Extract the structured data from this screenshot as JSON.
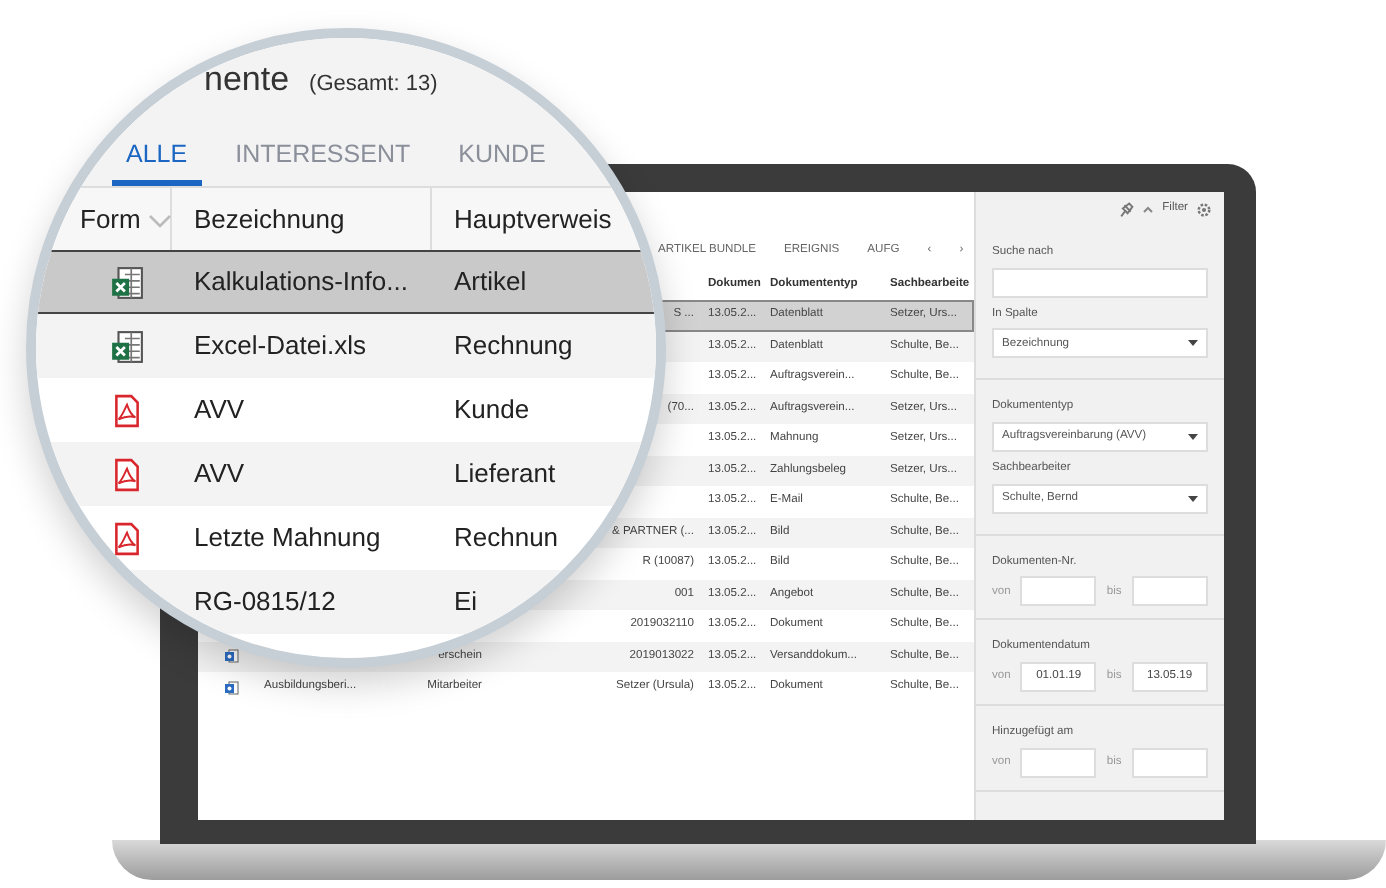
{
  "laptop_screen": {
    "tabs": [
      {
        "label": "ARTIKEL BUNDLE",
        "selected": false
      },
      {
        "label": "EREIGNIS",
        "selected": false
      },
      {
        "label": "AUFG",
        "selected": false
      }
    ],
    "tab_arrows": [
      "‹",
      "›"
    ],
    "table": {
      "columns": [
        "Dokumen",
        "Dokumententyp",
        "Sachbearbeite"
      ],
      "rows": [
        {
          "selected": true,
          "column_4": "S ...",
          "date": "13.05.2...",
          "type": "Datenblatt",
          "clerk": "Setzer, Urs..."
        },
        {
          "selected": false,
          "date": "13.05.2...",
          "type": "Datenblatt",
          "clerk": "Schulte, Be..."
        },
        {
          "selected": false,
          "date": "13.05.2...",
          "type": "Auftragsverein...",
          "clerk": "Schulte, Be..."
        },
        {
          "selected": false,
          "column_4": "(70...",
          "date": "13.05.2...",
          "type": "Auftragsverein...",
          "clerk": "Setzer, Urs..."
        },
        {
          "selected": false,
          "date": "13.05.2...",
          "type": "Mahnung",
          "clerk": "Setzer, Urs..."
        },
        {
          "selected": false,
          "date": "13.05.2...",
          "type": "Zahlungsbeleg",
          "clerk": "Setzer, Urs..."
        },
        {
          "selected": false,
          "date": "13.05.2...",
          "type": "E-Mail",
          "clerk": "Schulte, Be..."
        },
        {
          "selected": false,
          "column_4": "& PARTNER (...",
          "date": "13.05.2...",
          "type": "Bild",
          "clerk": "Schulte, Be..."
        },
        {
          "selected": false,
          "column_4": "R (10087)",
          "date": "13.05.2...",
          "type": "Bild",
          "clerk": "Schulte, Be..."
        },
        {
          "selected": false,
          "column_4": "001",
          "date": "13.05.2...",
          "type": "Angebot",
          "clerk": "Schulte, Be..."
        },
        {
          "selected": false,
          "column_4": "2019032110",
          "date": "13.05.2...",
          "type": "Dokument",
          "clerk": "Schulte, Be..."
        },
        {
          "selected": false,
          "kind": "word",
          "hauptverweis": "erschein",
          "column_4": "2019013022",
          "date": "13.05.2...",
          "type": "Versanddokum...",
          "clerk": "Schulte, Be..."
        },
        {
          "selected": false,
          "kind": "word",
          "bezeichnung": "Ausbildungsberi...",
          "hauptverweis": "Mitarbeiter",
          "column_4": "Setzer (Ursula)",
          "date": "13.05.2...",
          "type": "Dokument",
          "clerk": "Schulte, Be..."
        }
      ]
    },
    "filter": {
      "title": "Filter",
      "sections": [
        [
          {
            "kind": "text",
            "label": "Suche nach"
          },
          {
            "kind": "select",
            "label": "In Spalte",
            "value": "Bezeichnung"
          }
        ],
        [
          {
            "kind": "select",
            "label": "Dokumententyp",
            "value": "Auftragsvereinbarung (AVV)"
          },
          {
            "kind": "select",
            "label": "Sachbearbeiter",
            "value": "Schulte, Bernd"
          }
        ],
        [
          {
            "kind": "range",
            "label": "Dokumenten-Nr.",
            "from_label": "von",
            "to_label": "bis"
          }
        ],
        [
          {
            "kind": "range",
            "label": "Dokumentendatum",
            "from_label": "von",
            "from": "01.01.19",
            "to_label": "bis",
            "to": "13.05.19"
          }
        ],
        [
          {
            "kind": "range",
            "label": "Hinzugefügt am",
            "from_label": "von",
            "to_label": "bis"
          }
        ]
      ]
    }
  },
  "magnifier": {
    "title": "nente",
    "count": "(Gesamt: 13)",
    "tabs": [
      {
        "label": "ALLE",
        "selected": true
      },
      {
        "label": "INTERESSENT",
        "selected": false
      },
      {
        "label": "KUNDE",
        "selected": false
      }
    ],
    "columns": [
      "Form",
      "Bezeichnung",
      "Hauptverweis"
    ],
    "rows": [
      {
        "selected": true,
        "kind": "excel",
        "bezeichnung": "Kalkulations-Info...",
        "hauptverweis": "Artikel"
      },
      {
        "selected": false,
        "kind": "excel",
        "bezeichnung": "Excel-Datei.xls",
        "hauptverweis": "Rechnung"
      },
      {
        "selected": false,
        "kind": "pdf",
        "bezeichnung": "AVV",
        "hauptverweis": "Kunde"
      },
      {
        "selected": false,
        "kind": "pdf",
        "bezeichnung": "AVV",
        "hauptverweis": "Lieferant"
      },
      {
        "selected": false,
        "kind": "pdf",
        "bezeichnung": "Letzte Mahnung",
        "hauptverweis": "Rechnun"
      },
      {
        "selected": false,
        "bezeichnung": "RG-0815/12",
        "hauptverweis": "Ei"
      }
    ]
  }
}
